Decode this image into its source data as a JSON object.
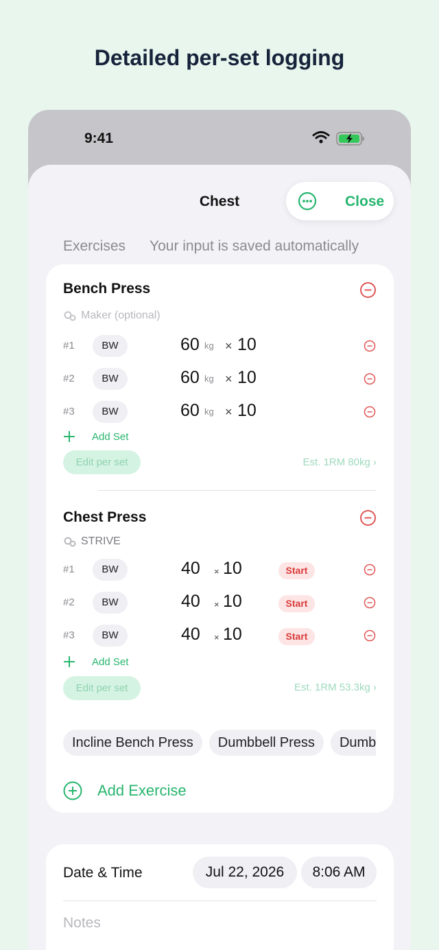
{
  "headline": "Detailed per-set logging",
  "status_bar": {
    "time": "9:41"
  },
  "sheet": {
    "title": "Chest",
    "close_label": "Close",
    "subheader_left": "Exercises",
    "subheader_right": "Your input is saved automatically"
  },
  "exercises": [
    {
      "name": "Bench Press",
      "maker": "Maker (optional)",
      "sets": [
        {
          "num": "#1",
          "type": "BW",
          "weight": "60",
          "unit": "kg",
          "times": "×",
          "reps": "10"
        },
        {
          "num": "#2",
          "type": "BW",
          "weight": "60",
          "unit": "kg",
          "times": "×",
          "reps": "10"
        },
        {
          "num": "#3",
          "type": "BW",
          "weight": "60",
          "unit": "kg",
          "times": "×",
          "reps": "10"
        }
      ],
      "add_set": "Add Set",
      "edit_per_set": "Edit per set",
      "est": "Est. 1RM 80kg ›"
    },
    {
      "name": "Chest Press",
      "maker": "STRIVE",
      "sets": [
        {
          "num": "#1",
          "type": "BW",
          "weight": "40",
          "times": "×",
          "reps": "10",
          "action": "Start"
        },
        {
          "num": "#2",
          "type": "BW",
          "weight": "40",
          "times": "×",
          "reps": "10",
          "action": "Start"
        },
        {
          "num": "#3",
          "type": "BW",
          "weight": "40",
          "times": "×",
          "reps": "10",
          "action": "Start"
        }
      ],
      "add_set": "Add Set",
      "edit_per_set": "Edit per set",
      "est": "Est. 1RM 53.3kg ›"
    }
  ],
  "suggestions": [
    "Incline Bench Press",
    "Dumbbell Press",
    "Dumbbell Fly"
  ],
  "add_exercise": "Add Exercise",
  "details": {
    "date_time_label": "Date & Time",
    "date": "Jul 22, 2026",
    "time": "8:06 AM",
    "notes_placeholder": "Notes"
  },
  "colors": {
    "accent": "#27b56e",
    "danger": "#e05555",
    "background": "#e8f6ee",
    "sheet": "#f2f2f7"
  }
}
